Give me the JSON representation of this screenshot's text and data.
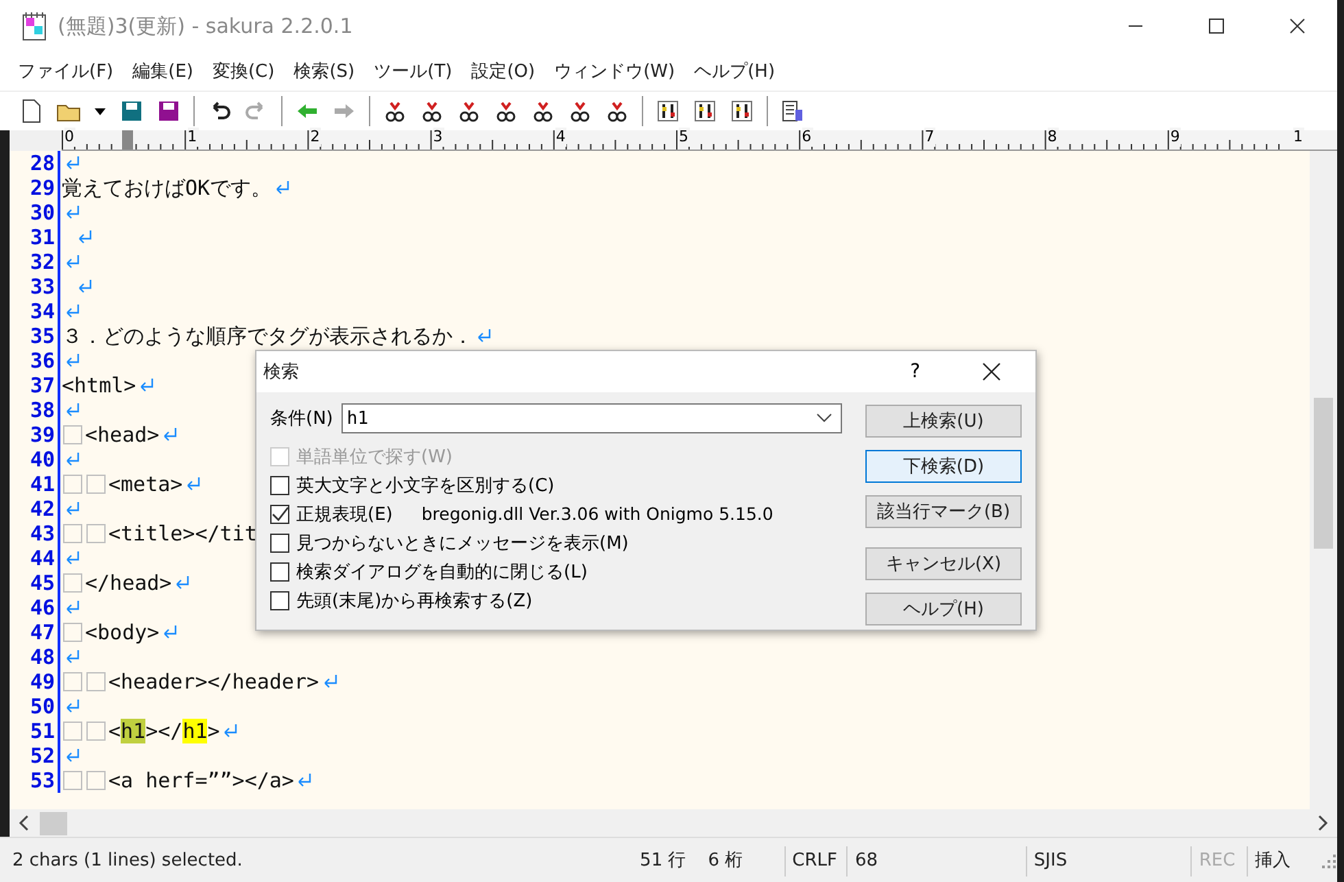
{
  "window": {
    "title": "(無題)3(更新) - sakura 2.2.0.1"
  },
  "menu": [
    "ファイル(F)",
    "編集(E)",
    "変換(C)",
    "検索(S)",
    "ツール(T)",
    "設定(O)",
    "ウィンドウ(W)",
    "ヘルプ(H)"
  ],
  "ruler": {
    "labels": [
      "0",
      "1",
      "2",
      "3",
      "4",
      "5",
      "6",
      "7",
      "8",
      "9",
      "1"
    ]
  },
  "lines": [
    {
      "number": "28"
    },
    {
      "number": "29",
      "segments": [
        {
          "kind": "text",
          "text": "覚えておけばOKです。"
        }
      ]
    },
    {
      "number": "30"
    },
    {
      "number": "31",
      "segments": [
        {
          "kind": "gap"
        }
      ]
    },
    {
      "number": "32"
    },
    {
      "number": "33",
      "segments": [
        {
          "kind": "gap"
        }
      ]
    },
    {
      "number": "34"
    },
    {
      "number": "35",
      "segments": [
        {
          "kind": "text",
          "text": "３．どのような順序でタグが表示されるか．"
        }
      ]
    },
    {
      "number": "36"
    },
    {
      "number": "37",
      "segments": [
        {
          "kind": "text",
          "text": "<html>"
        }
      ]
    },
    {
      "number": "38"
    },
    {
      "number": "39",
      "segments": [
        {
          "kind": "space"
        },
        {
          "kind": "text",
          "text": "<head>"
        }
      ]
    },
    {
      "number": "40"
    },
    {
      "number": "41",
      "segments": [
        {
          "kind": "space"
        },
        {
          "kind": "space"
        },
        {
          "kind": "text",
          "text": "<meta>"
        }
      ]
    },
    {
      "number": "42"
    },
    {
      "number": "43",
      "segments": [
        {
          "kind": "space"
        },
        {
          "kind": "space"
        },
        {
          "kind": "text",
          "text": "<title></tit"
        }
      ]
    },
    {
      "number": "44"
    },
    {
      "number": "45",
      "segments": [
        {
          "kind": "space"
        },
        {
          "kind": "text",
          "text": "</head>"
        }
      ]
    },
    {
      "number": "46"
    },
    {
      "number": "47",
      "segments": [
        {
          "kind": "space"
        },
        {
          "kind": "text",
          "text": "<body>"
        }
      ]
    },
    {
      "number": "48"
    },
    {
      "number": "49",
      "segments": [
        {
          "kind": "space"
        },
        {
          "kind": "space"
        },
        {
          "kind": "text",
          "text": "<header></header>"
        }
      ]
    },
    {
      "number": "50"
    },
    {
      "number": "51",
      "segments": [
        {
          "kind": "space"
        },
        {
          "kind": "space"
        },
        {
          "kind": "text",
          "text": "<"
        },
        {
          "kind": "match",
          "selected": true,
          "text": "h1"
        },
        {
          "kind": "text",
          "text": "></"
        },
        {
          "kind": "match",
          "selected": false,
          "text": "h1"
        },
        {
          "kind": "text",
          "text": ">"
        }
      ]
    },
    {
      "number": "52"
    },
    {
      "number": "53",
      "segments": [
        {
          "kind": "space"
        },
        {
          "kind": "space"
        },
        {
          "kind": "text",
          "text": "<a herf=””></a>"
        }
      ]
    }
  ],
  "dialog": {
    "title": "検索",
    "help": "?",
    "condition_label": "条件(N)",
    "condition_value": "h1",
    "options": [
      {
        "label": "単語単位で探す(W)",
        "checked": false,
        "disabled": true
      },
      {
        "label": "英大文字と小文字を区別する(C)",
        "checked": false,
        "disabled": false
      },
      {
        "label": "正規表現(E)",
        "checked": true,
        "disabled": false,
        "note": "bregonig.dll Ver.3.06 with Onigmo 5.15.0"
      },
      {
        "label": "見つからないときにメッセージを表示(M)",
        "checked": false,
        "disabled": false
      },
      {
        "label": "検索ダイアログを自動的に閉じる(L)",
        "checked": false,
        "disabled": false
      },
      {
        "label": "先頭(末尾)から再検索する(Z)",
        "checked": false,
        "disabled": false
      }
    ],
    "buttons": [
      {
        "label": "上検索(U)",
        "default": false
      },
      {
        "label": "下検索(D)",
        "default": true
      },
      {
        "label": "該当行マーク(B)",
        "default": false
      },
      {
        "label": "キャンセル(X)",
        "default": false
      },
      {
        "label": "ヘルプ(H)",
        "default": false
      }
    ]
  },
  "status_bar": {
    "message": "2 chars (1 lines) selected.",
    "row": "51 行",
    "column": "6 桁",
    "line_ending": "CRLF",
    "code": "68",
    "encoding": "SJIS",
    "rec": {
      "text": "REC",
      "disabled": true
    },
    "mode": "挿入"
  }
}
